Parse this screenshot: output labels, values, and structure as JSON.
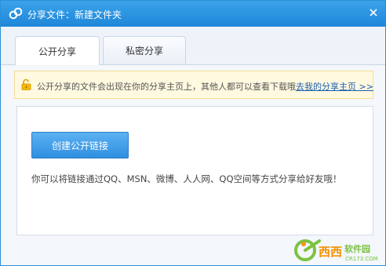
{
  "window": {
    "title": "分享文件：新建文件夹"
  },
  "tabs": [
    {
      "label": "公开分享",
      "active": true
    },
    {
      "label": "私密分享",
      "active": false
    }
  ],
  "notice": {
    "text": "公开分享的文件会出现在你的分享主页上，其他人都可以查看下载哦",
    "link": "去我的分享主页 >>"
  },
  "panel": {
    "create_button": "创建公开链接",
    "info": "你可以将链接通过QQ、MSN、微博、人人网、QQ空间等方式分享给好友哦！"
  },
  "watermark": {
    "brand": "西西软件园",
    "site": "CR173.COM"
  },
  "colors": {
    "titlebar": "#2b93e0",
    "button": "#3e9fe8",
    "notice_bg": "#fff9df",
    "link": "#1a5fb4"
  }
}
